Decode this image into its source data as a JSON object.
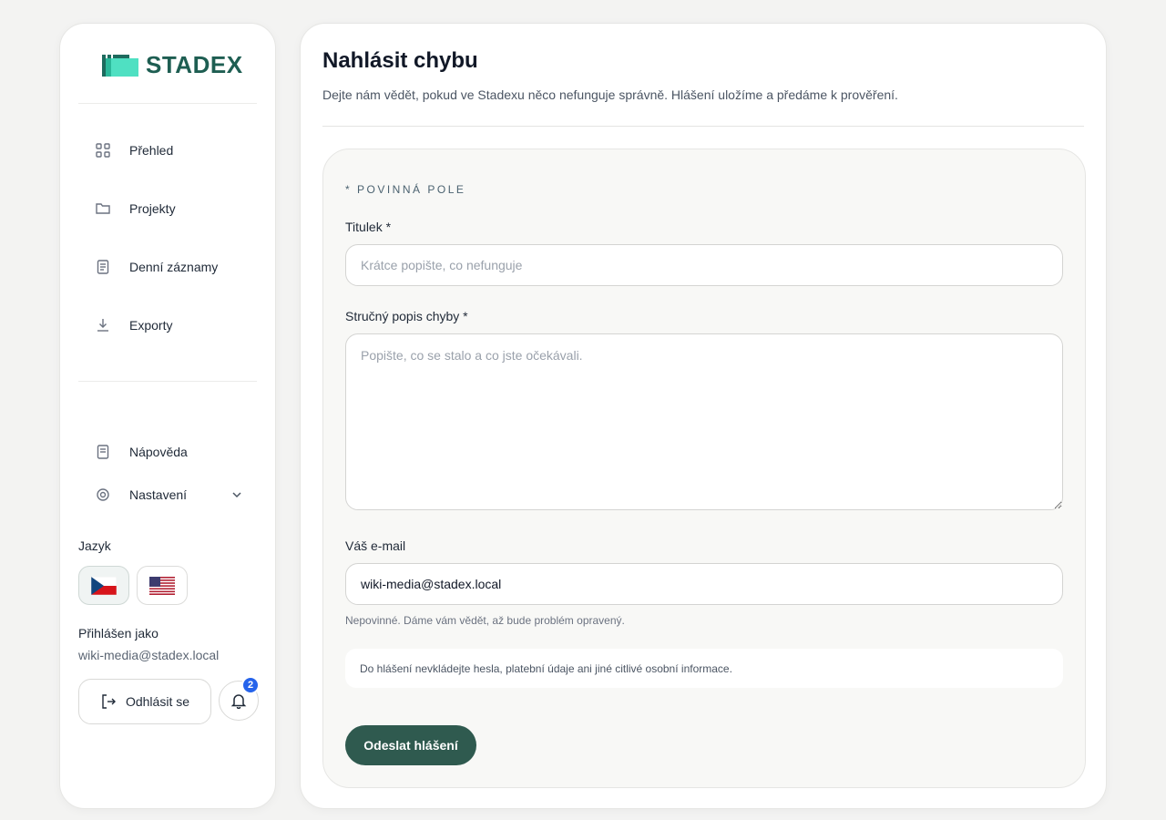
{
  "brand": {
    "name": "STADEX",
    "color": "#1e5e52"
  },
  "sidebar": {
    "nav": [
      {
        "label": "Přehled",
        "icon": "grid-icon"
      },
      {
        "label": "Projekty",
        "icon": "folder-icon"
      },
      {
        "label": "Denní záznamy",
        "icon": "document-icon"
      },
      {
        "label": "Exporty",
        "icon": "download-icon"
      }
    ],
    "help_label": "Nápověda",
    "settings_label": "Nastavení",
    "language_label": "Jazyk",
    "logged_in_label": "Přihlášen jako",
    "logged_in_email": "wiki-media@stadex.local",
    "logout_label": "Odhlásit se",
    "notification_count": "2"
  },
  "main": {
    "title": "Nahlásit chybu",
    "description": "Dejte nám vědět, pokud ve Stadexu něco nefunguje správně. Hlášení uložíme a předáme k prověření.",
    "form": {
      "required_note": "* POVINNÁ POLE",
      "title_label": "Titulek *",
      "title_placeholder": "Krátce popište, co nefunguje",
      "description_label": "Stručný popis chyby *",
      "description_placeholder": "Popište, co se stalo a co jste očekávali.",
      "email_label": "Váš e-mail",
      "email_value": "wiki-media@stadex.local",
      "email_hint": "Nepovinné. Dáme vám vědět, až bude problém opravený.",
      "notice": "Do hlášení nevkládejte hesla, platební údaje ani jiné citlivé osobní informace.",
      "submit_label": "Odeslat hlášení"
    }
  },
  "colors": {
    "accent": "#2f5a4f",
    "badge": "#2563eb"
  }
}
